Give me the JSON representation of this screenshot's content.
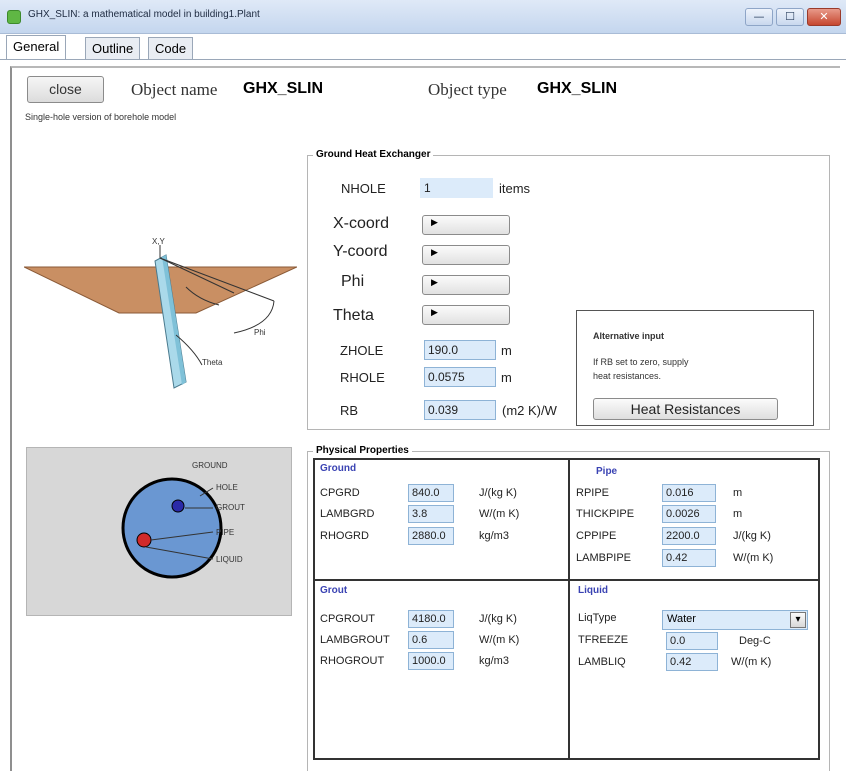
{
  "window": {
    "title": "GHX_SLIN: a mathematical model in building1.Plant",
    "minimize": "—",
    "maximize": "☐",
    "close": "✕"
  },
  "tabs": [
    {
      "label": "General",
      "active": true
    },
    {
      "label": "Outline",
      "active": false
    },
    {
      "label": "Code",
      "active": false
    }
  ],
  "header": {
    "close_label": "close",
    "object_name_label": "Object name",
    "object_name": "GHX_SLIN",
    "object_type_label": "Object type",
    "object_type": "GHX_SLIN",
    "description": "Single-hole version of borehole model"
  },
  "diagram1": {
    "xy": "X,Y",
    "phi": "Phi",
    "theta": "Theta"
  },
  "diagram2": {
    "ground": "GROUND",
    "hole": "HOLE",
    "grout": "GROUT",
    "pipe": "PIPE",
    "liquid": "LIQUID"
  },
  "ghx": {
    "title": "Ground Heat Exchanger",
    "nhole_label": "NHOLE",
    "nhole_value": "1",
    "nhole_unit": "items",
    "xcoord_label": "X-coord",
    "ycoord_label": "Y-coord",
    "phi_label": "Phi",
    "theta_label": "Theta",
    "arrow": "▶",
    "zhole_label": "ZHOLE",
    "zhole_value": "190.0",
    "zhole_unit": "m",
    "rhole_label": "RHOLE",
    "rhole_value": "0.0575",
    "rhole_unit": "m",
    "rb_label": "RB",
    "rb_value": "0.039",
    "rb_unit": "(m2 K)/W",
    "alt_title": "Alternative input",
    "alt_text1": "If RB set to zero, supply",
    "alt_text2": "heat resistances.",
    "heat_res_button": "Heat Resistances"
  },
  "physical": {
    "title": "Physical Properties",
    "ground": {
      "title": "Ground",
      "rows": [
        {
          "label": "CPGRD",
          "value": "840.0",
          "unit": "J/(kg K)"
        },
        {
          "label": "LAMBGRD",
          "value": "3.8",
          "unit": "W/(m K)"
        },
        {
          "label": "RHOGRD",
          "value": "2880.0",
          "unit": "kg/m3"
        }
      ]
    },
    "pipe": {
      "title": "Pipe",
      "rows": [
        {
          "label": "RPIPE",
          "value": "0.016",
          "unit": "m"
        },
        {
          "label": "THICKPIPE",
          "value": "0.0026",
          "unit": "m"
        },
        {
          "label": "CPPIPE",
          "value": "2200.0",
          "unit": "J/(kg K)"
        },
        {
          "label": "LAMBPIPE",
          "value": "0.42",
          "unit": "W/(m K)"
        }
      ]
    },
    "grout": {
      "title": "Grout",
      "rows": [
        {
          "label": "CPGROUT",
          "value": "4180.0",
          "unit": "J/(kg K)"
        },
        {
          "label": "LAMBGROUT",
          "value": "0.6",
          "unit": "W/(m K)"
        },
        {
          "label": "RHOGROUT",
          "value": "1000.0",
          "unit": "kg/m3"
        }
      ]
    },
    "liquid": {
      "title": "Liquid",
      "liqtype_label": "LiqType",
      "liqtype_value": "Water",
      "dropdown_arrow": "▾",
      "rows": [
        {
          "label": "TFREEZE",
          "value": "0.0",
          "unit": "Deg-C"
        },
        {
          "label": "LAMBLIQ",
          "value": "0.42",
          "unit": "W/(m K)"
        }
      ]
    }
  },
  "colors": {
    "field_bg": "#dcebfa",
    "section_header": "#3a43b3",
    "ground_plane": "#c98f63",
    "pipe_fill": "#aad9ea",
    "borehole_circle": "#6a97d2"
  }
}
